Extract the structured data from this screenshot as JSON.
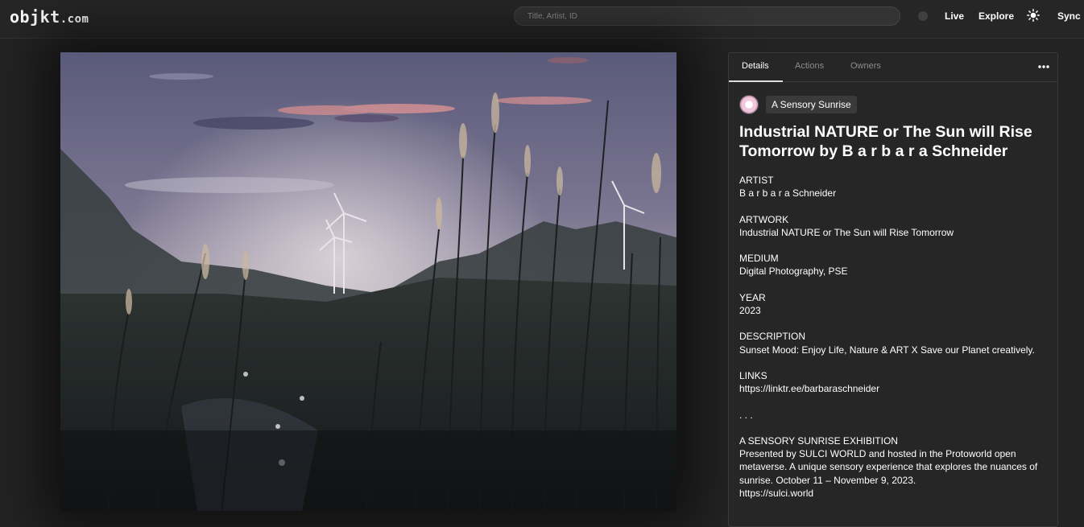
{
  "header": {
    "logo": "objkt",
    "logo_suffix": ".com",
    "search_placeholder": "Title, Artist, ID",
    "nav": [
      "Live",
      "Explore",
      "Sync"
    ],
    "theme_icon": "sun-icon",
    "status_icon": "dot-icon"
  },
  "artwork": {
    "image_alt": "Industrial NATURE or The Sun will Rise Tomorrow"
  },
  "panel": {
    "tabs": [
      "Details",
      "Actions",
      "Owners"
    ],
    "active_tab": "Details",
    "more_icon": "more-icon",
    "collection_name": "A Sensory Sunrise",
    "title": "Industrial NATURE or The Sun will Rise Tomorrow by B a r b a r a Schneider",
    "sections": [
      {
        "label": "ARTIST",
        "value": "B a r b a r a Schneider"
      },
      {
        "label": "ARTWORK",
        "value": "Industrial NATURE or The Sun will Rise Tomorrow"
      },
      {
        "label": "MEDIUM",
        "value": "Digital Photography, PSE"
      },
      {
        "label": "YEAR",
        "value": "2023"
      },
      {
        "label": "DESCRIPTION",
        "value": "Sunset Mood: Enjoy Life, Nature & ART X Save our Planet creatively."
      },
      {
        "label": "LINKS",
        "value": "https://linktr.ee/barbaraschneider"
      }
    ],
    "ellipsis": ". . .",
    "exhibition_title": "A SENSORY SUNRISE EXHIBITION",
    "exhibition_text": "Presented by SULCI WORLD and hosted in the Protoworld open metaverse. A unique sensory experience that explores the nuances of sunrise. October 11 – November 9, 2023.",
    "exhibition_link": "https://sulci.world"
  },
  "colors": {
    "background": "#232323",
    "panel": "#262626",
    "accent_text": "#ffffff",
    "muted_text": "#8c8c8c"
  }
}
